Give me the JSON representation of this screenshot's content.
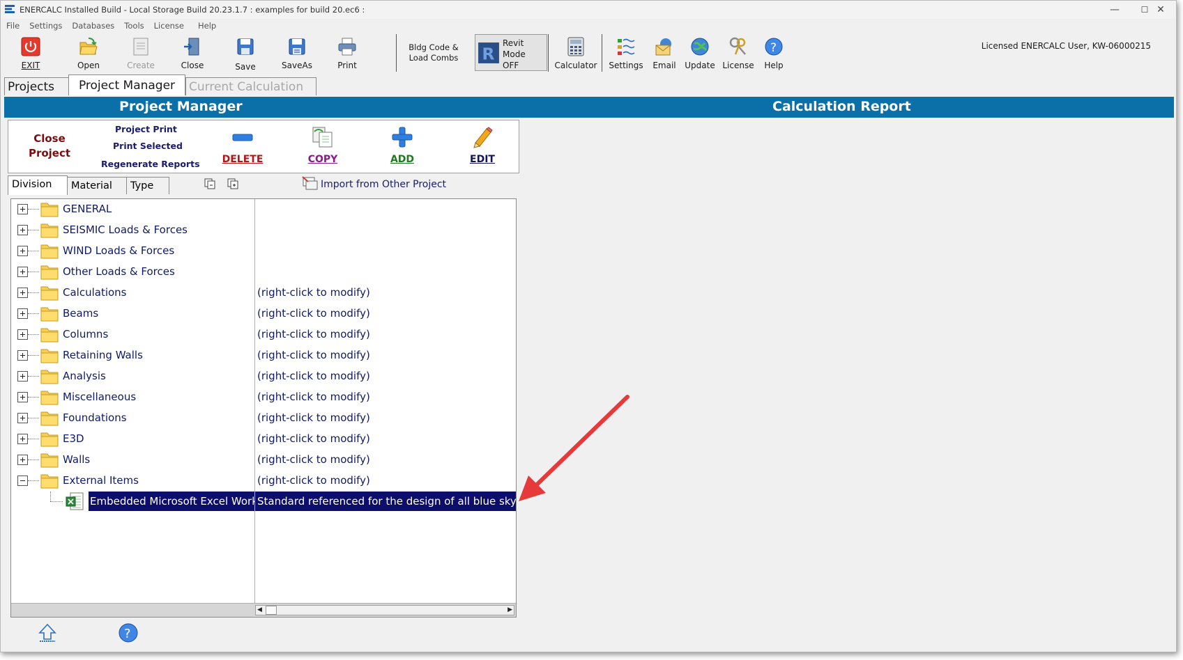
{
  "window": {
    "title": "ENERCALC Installed Build - Local Storage Build 20.23.1.7 :   examples for build 20.ec6 :",
    "controls": {
      "minimize": "—",
      "maximize": "☐",
      "close": "✕"
    }
  },
  "menu": [
    "File",
    "Settings",
    "Databases",
    "Tools",
    "License",
    "Help"
  ],
  "toolbar": {
    "exit": "EXIT",
    "open": "Open",
    "create": "Create",
    "close": "Close",
    "save": "Save",
    "saveas": "SaveAs",
    "print": "Print",
    "bldg_code": "Bldg Code &",
    "load_combs": "Load Combs",
    "revit_line1": "Revit",
    "revit_line2": "Mode",
    "revit_line3": "OFF",
    "calculator": "Calculator",
    "settings": "Settings",
    "email": "Email",
    "update": "Update",
    "license": "License",
    "help": "Help",
    "licensed_user": "Licensed ENERCALC User, KW-06000215"
  },
  "tabs": {
    "projects": "Projects",
    "project_manager": "Project Manager",
    "current_calculation": "Current Calculation"
  },
  "header": {
    "project_manager": "Project Manager",
    "calculation_report": "Calculation Report"
  },
  "pm_panel": {
    "close_line1": "Close",
    "close_line2": "Project",
    "project_print": "Project Print",
    "print_selected": "Print Selected",
    "regenerate_reports": "Regenerate Reports",
    "delete": "DELETE",
    "copy": "COPY",
    "add": "ADD",
    "edit": "EDIT"
  },
  "subtabs": {
    "division": "Division",
    "material": "Material",
    "type": "Type"
  },
  "import_label": "Import from Other Project",
  "tree": {
    "items": [
      {
        "name": "GENERAL",
        "desc": ""
      },
      {
        "name": "SEISMIC Loads & Forces",
        "desc": ""
      },
      {
        "name": "WIND Loads & Forces",
        "desc": ""
      },
      {
        "name": "Other Loads & Forces",
        "desc": ""
      },
      {
        "name": "Calculations",
        "desc": "(right-click to modify)"
      },
      {
        "name": "Beams",
        "desc": "(right-click to modify)"
      },
      {
        "name": "Columns",
        "desc": "(right-click to modify)"
      },
      {
        "name": "Retaining Walls",
        "desc": "(right-click to modify)"
      },
      {
        "name": "Analysis",
        "desc": "(right-click to modify)"
      },
      {
        "name": "Miscellaneous",
        "desc": "(right-click to modify)"
      },
      {
        "name": "Foundations",
        "desc": "(right-click to modify)"
      },
      {
        "name": "E3D",
        "desc": "(right-click to modify)"
      },
      {
        "name": "Walls",
        "desc": "(right-click to modify)"
      },
      {
        "name": "External Items",
        "desc": "(right-click to modify)"
      }
    ],
    "selected_child": {
      "name": "Embedded Microsoft Excel Worksh",
      "desc": "Standard referenced for the design of all blue skyhoo"
    }
  },
  "colors": {
    "header_blue": "#0b6fa8",
    "selection": "#0d0d6b",
    "arrow": "#e63a3a",
    "tree_text": "#0f1a6a"
  }
}
